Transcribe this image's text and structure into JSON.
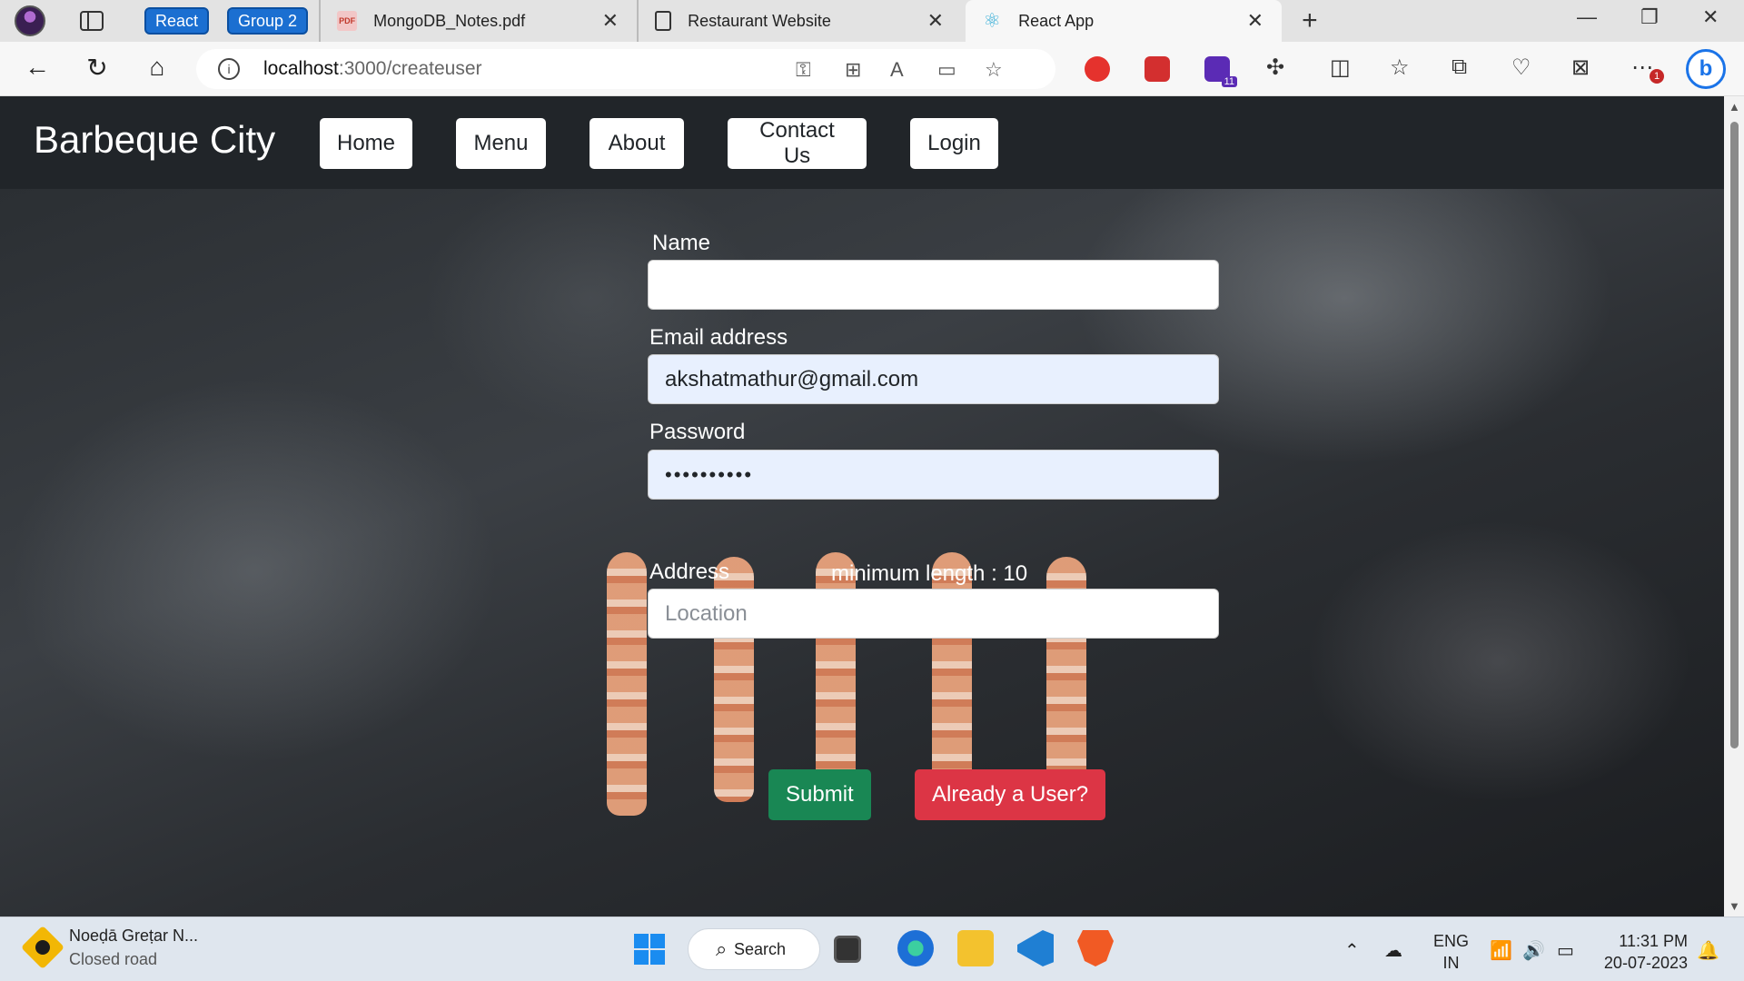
{
  "browser": {
    "tab_groups": [
      "React",
      "Group 2"
    ],
    "tabs": [
      {
        "title": "MongoDB_Notes.pdf",
        "icon": "pdf-icon"
      },
      {
        "title": "Restaurant Website",
        "icon": "page-icon"
      },
      {
        "title": "React App",
        "icon": "react-icon",
        "active": true
      }
    ],
    "url_host": "localhost",
    "url_path": ":3000/createuser",
    "extension_badge": "11",
    "notification_badge": "1"
  },
  "site": {
    "brand": "Barbeque City",
    "nav": [
      "Home",
      "Menu",
      "About",
      "Contact Us",
      "Login"
    ]
  },
  "form": {
    "name_label": "Name",
    "name_value": "",
    "email_label": "Email address",
    "email_value": "akshatmathur@gmail.com",
    "password_label": "Password",
    "password_mask": "••••••••••",
    "password_hint": "minimum length : 10",
    "address_label": "Address",
    "address_placeholder": "Location",
    "submit_label": "Submit",
    "existing_user_label": "Already a User?"
  },
  "taskbar": {
    "weather_title": "Noeḍā Greṭar N...",
    "weather_sub": "Closed road",
    "search_label": "Search",
    "lang_line1": "ENG",
    "lang_line2": "IN",
    "time": "11:31 PM",
    "date": "20-07-2023"
  },
  "colors": {
    "navbar": "#212529",
    "success": "#198754",
    "danger": "#dc3545",
    "autofill": "#e8f0fe"
  }
}
